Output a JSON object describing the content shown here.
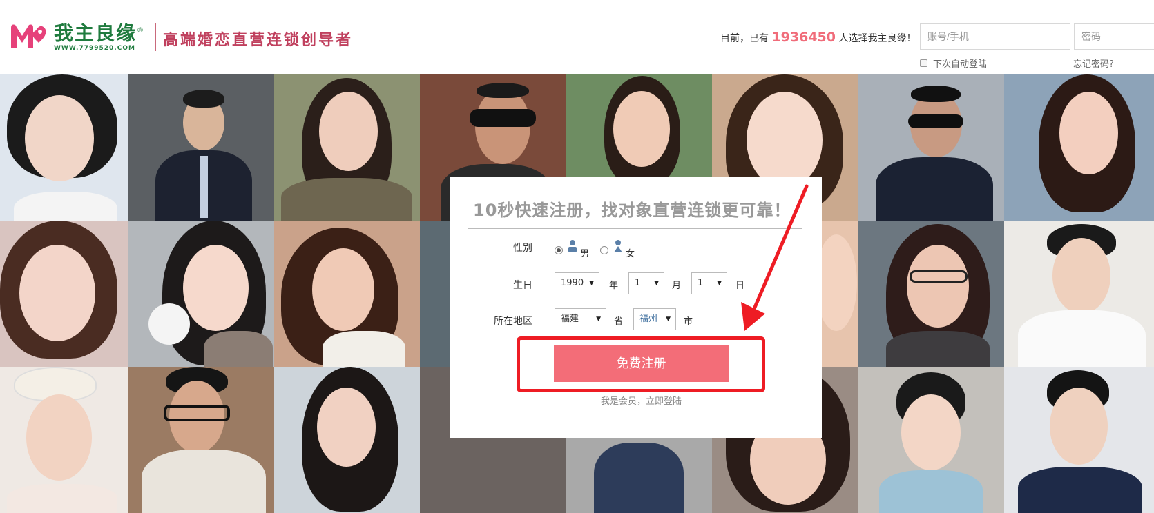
{
  "header": {
    "logo_cn": "我主良缘",
    "logo_reg": "®",
    "logo_url": "WWW.7799520.COM",
    "slogan": "高端婚恋直营连锁创导者",
    "count_prefix": "目前，已有",
    "count_number": "1936450",
    "count_suffix": "人选择我主良缘！",
    "account_placeholder": "账号/手机",
    "password_placeholder": "密码",
    "remember_label": "下次自动登陆",
    "forgot_label": "忘记密码?"
  },
  "register": {
    "title": "10秒快速注册，找对象直营连锁更可靠！",
    "gender_label": "性别",
    "male": "男",
    "female": "女",
    "male_selected": true,
    "birthday_label": "生日",
    "year": "1990",
    "year_unit": "年",
    "month": "1",
    "month_unit": "月",
    "day": "1",
    "day_unit": "日",
    "region_label": "所在地区",
    "province": "福建",
    "province_unit": "省",
    "city": "福州",
    "city_unit": "市",
    "submit_label": "免费注册",
    "member_link": "我是会员，立即登陆"
  },
  "colors": {
    "accent": "#f36d78",
    "count": "#f06c7a",
    "logo_green": "#1f7b3e",
    "annotation": "#ee1c24"
  }
}
